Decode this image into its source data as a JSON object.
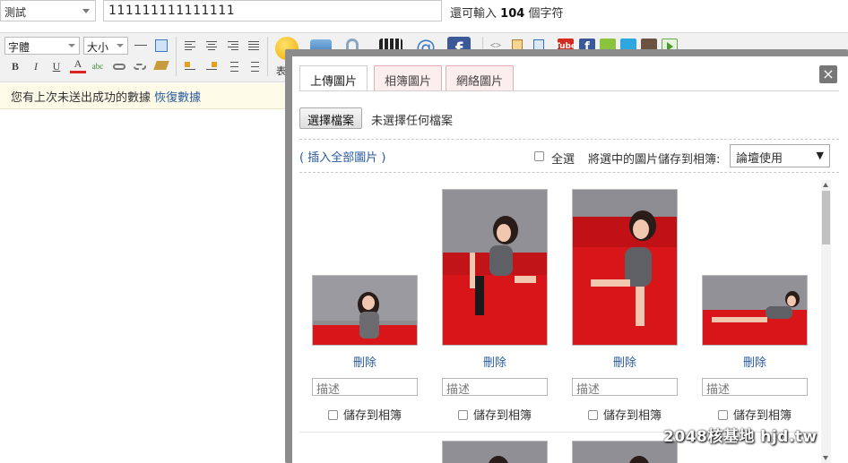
{
  "topbar": {
    "type_select_value": "測試",
    "title_value": "111111111111111",
    "char_hint_prefix": "還可輸入",
    "char_hint_count": "104",
    "char_hint_suffix": "個字符"
  },
  "toolbar": {
    "font_select": "字體",
    "size_select": "大小",
    "bold": "B",
    "italic": "I",
    "underline": "U",
    "font_color": "A",
    "emoji_label": "表",
    "icons": [
      "font-select",
      "size-select",
      "horizontal-rule-icon",
      "table-icon",
      "align-left-icon",
      "align-center-icon",
      "align-right-icon",
      "justify-icon",
      "bold-icon",
      "italic-icon",
      "underline-icon",
      "font-color-icon",
      "spellcheck-icon",
      "link-icon",
      "unlink-icon",
      "clear-format-icon",
      "image-align-left-icon",
      "image-align-right-icon",
      "ordered-list-icon",
      "unordered-list-icon",
      "emoji-icon",
      "image-icon",
      "attachment-icon",
      "video-icon",
      "at-icon",
      "facebook-icon",
      "code-icon",
      "html-icon",
      "file-icon",
      "youtube-icon",
      "facebook-small-icon",
      "android-icon",
      "twitter-icon",
      "instagram-icon",
      "media-play-icon"
    ],
    "youtube_text": "Tube"
  },
  "notice": {
    "text": "您有上次未送出成功的數據",
    "link": "恢復數據"
  },
  "dialog": {
    "tabs": [
      {
        "label": "上傳圖片",
        "active": true
      },
      {
        "label": "相簿圖片",
        "active": false
      },
      {
        "label": "網絡圖片",
        "active": false
      }
    ],
    "close": "×",
    "choose_file_button": "選擇檔案",
    "no_file_text": "未選擇任何檔案",
    "insert_all": "( 插入全部圖片 )",
    "select_all": "全選",
    "save_selected_label": "將選中的圖片儲存到相簿:",
    "album_select_value": "論壇使用",
    "album_select_arrow": "▼",
    "images": [
      {
        "delete": "刪除",
        "description_placeholder": "描述",
        "save_label": "儲存到相簿",
        "orientation": "landscape"
      },
      {
        "delete": "刪除",
        "description_placeholder": "描述",
        "save_label": "儲存到相簿",
        "orientation": "portrait"
      },
      {
        "delete": "刪除",
        "description_placeholder": "描述",
        "save_label": "儲存到相簿",
        "orientation": "portrait"
      },
      {
        "delete": "刪除",
        "description_placeholder": "描述",
        "save_label": "儲存到相簿",
        "orientation": "landscape"
      }
    ]
  },
  "watermark": "2048核基地 hjd.tw",
  "colors": {
    "link": "#2a5b9f",
    "tab_inactive_bg": "#fdeeee",
    "dialog_frame": "#8c8c8c",
    "notice_bg": "#fdfae8",
    "photo_red": "#d8161a"
  }
}
